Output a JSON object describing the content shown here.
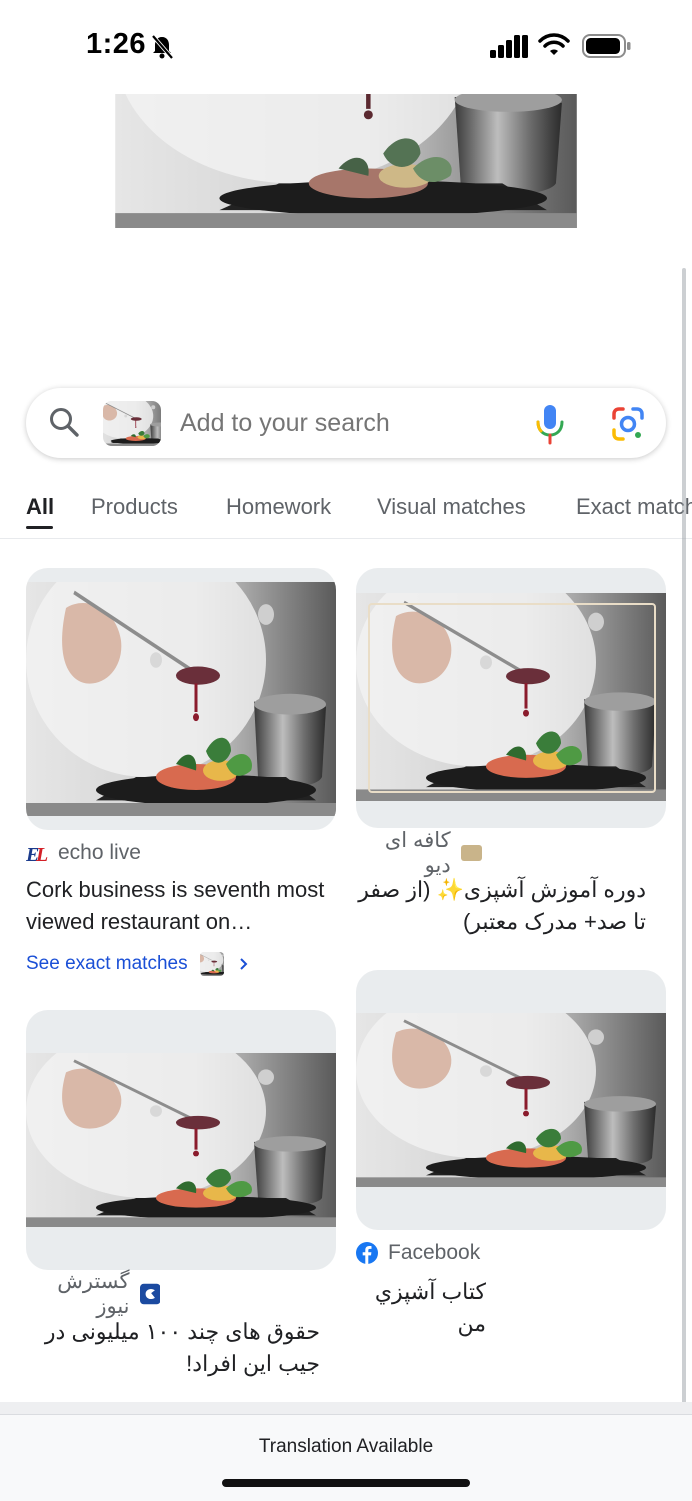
{
  "status_bar": {
    "time": "1:26"
  },
  "search": {
    "placeholder": "Add to your search"
  },
  "tabs": [
    {
      "label": "All",
      "active": true
    },
    {
      "label": "Products"
    },
    {
      "label": "Homework"
    },
    {
      "label": "Visual matches"
    },
    {
      "label": "Exact matches"
    }
  ],
  "results": [
    {
      "source": "echo live",
      "source_logo": "EL",
      "title": "Cork business is seventh most viewed restaurant on…",
      "exact_matches_label": "See exact matches"
    },
    {
      "source": "کافه ای دیو",
      "title": "دوره آموزش آشپزی✨ (از صفر تا صد+ مدرک معتبر)"
    },
    {
      "source": "گسترش نیوز",
      "title": "حقوق های چند ۱۰۰ میلیونی در جیب این افراد!"
    },
    {
      "source": "Facebook",
      "title": "كتاب آشپزي من"
    }
  ],
  "bottom": {
    "translation": "Translation Available"
  },
  "colors": {
    "link": "#1a4fd6",
    "facebook": "#1877f2",
    "echo_live_red": "#d32027",
    "echo_live_blue": "#1b3b8c"
  }
}
